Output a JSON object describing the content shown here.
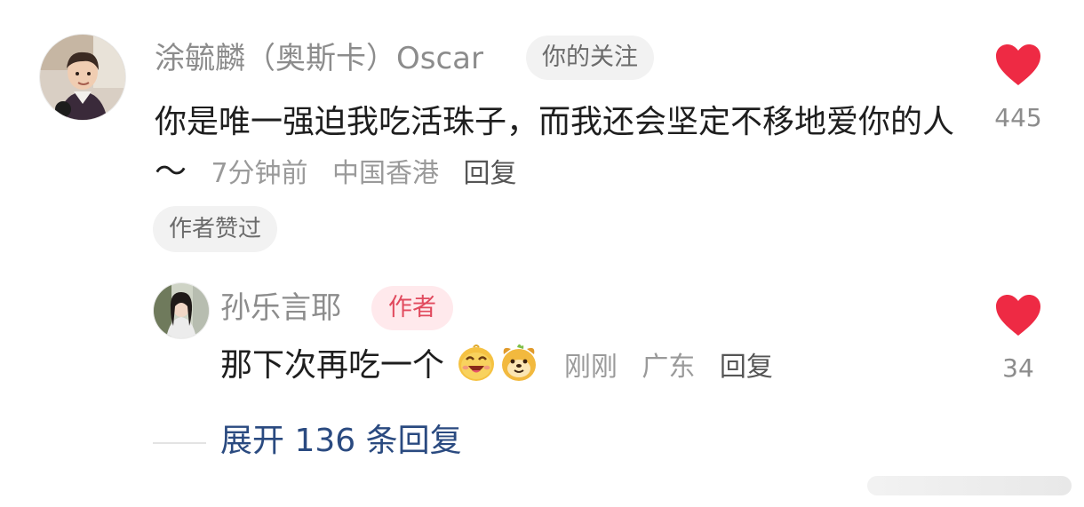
{
  "comment": {
    "username": "涂毓麟（奥斯卡）Oscar",
    "follow_tag": "你的关注",
    "text": "你是唯一强迫我吃活珠子，而我还会坚定不移地爱你的人～",
    "time": "7分钟前",
    "location": "中国香港",
    "reply_label": "回复",
    "author_liked_badge": "作者赞过",
    "likes": "445"
  },
  "reply": {
    "username": "孙乐言耶",
    "author_tag": "作者",
    "text": "那下次再吃一个",
    "time": "刚刚",
    "location": "广东",
    "reply_label": "回复",
    "likes": "34"
  },
  "expand": {
    "label": "展开 136 条回复"
  },
  "colors": {
    "heart": "#ee2a44",
    "author_tag_text": "#e14a5e",
    "expand_link": "#2a4a80"
  },
  "icons": {
    "like": "heart-icon",
    "emoji_1": "laughing-face-emoji",
    "emoji_2": "dog-face-emoji"
  }
}
